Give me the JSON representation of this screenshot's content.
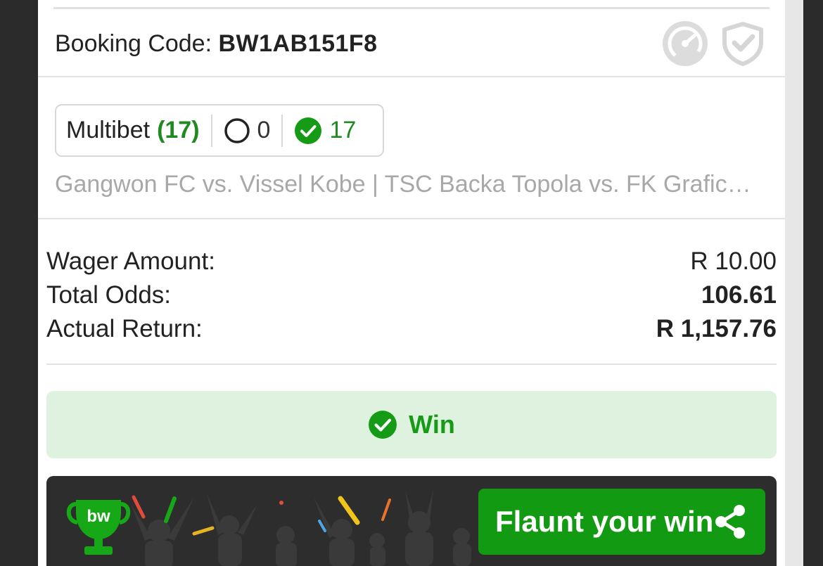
{
  "booking": {
    "label": "Booking Code:",
    "code": "BW1AB151F8"
  },
  "chip": {
    "label": "Multibet",
    "count": "(17)",
    "pending": "0",
    "won": "17"
  },
  "matches_text": "Gangwon FC vs. Vissel Kobe | TSC Backa Topola vs. FK Grafic…",
  "summary": {
    "wager_label": "Wager Amount:",
    "wager_value": "R 10.00",
    "odds_label": "Total Odds:",
    "odds_value": "106.61",
    "return_label": "Actual Return:",
    "return_value": "R 1,157.76"
  },
  "result": {
    "status": "Win",
    "color": "#159b15"
  },
  "promo": {
    "logo_text": "bw",
    "button_label": "Flaunt your win"
  },
  "icons": [
    "gauge-icon",
    "shield-check-icon",
    "circle-outline-icon",
    "check-circle-icon",
    "trophy-icon",
    "share-icon"
  ]
}
